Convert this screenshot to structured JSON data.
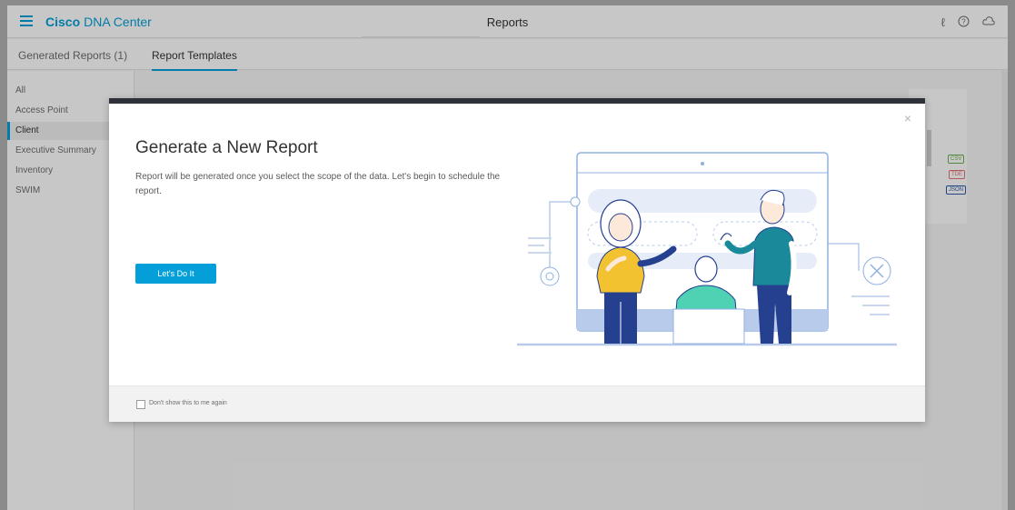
{
  "header": {
    "brand_bold": "Cisco",
    "brand_rest": "DNA Center",
    "title": "Reports"
  },
  "icons": {
    "menu": "hamburger-menu-icon",
    "notifications": "notification-icon",
    "help": "help-circle-icon",
    "cloud": "cloud-icon"
  },
  "tabs": [
    {
      "label": "Generated Reports (1)"
    },
    {
      "label": "Report Templates"
    }
  ],
  "sidebar": {
    "items": [
      {
        "label": "All"
      },
      {
        "label": "Access Point"
      },
      {
        "label": "Client"
      },
      {
        "label": "Executive Summary"
      },
      {
        "label": "Inventory"
      },
      {
        "label": "SWIM"
      }
    ],
    "active": "Client"
  },
  "background_card": {
    "formats": [
      "CSV",
      "TDE",
      "JSON"
    ]
  },
  "modal": {
    "title": "Generate a New Report",
    "description": "Report will be generated once you select the scope of the data. Let's begin to schedule the report.",
    "cta_label": "Let's Do It",
    "checkbox_label": "Don't show this to me again",
    "close_glyph": "×"
  },
  "colors": {
    "accent": "#049fd9",
    "modal_header": "#2f3138",
    "csv": "#6ab04c",
    "tde": "#e57373",
    "json": "#2b5aa8",
    "illustration_blue": "#8fb1e0",
    "person_yellow": "#f2c230",
    "person_teal": "#1a8a9a",
    "person_navy": "#25408f"
  }
}
